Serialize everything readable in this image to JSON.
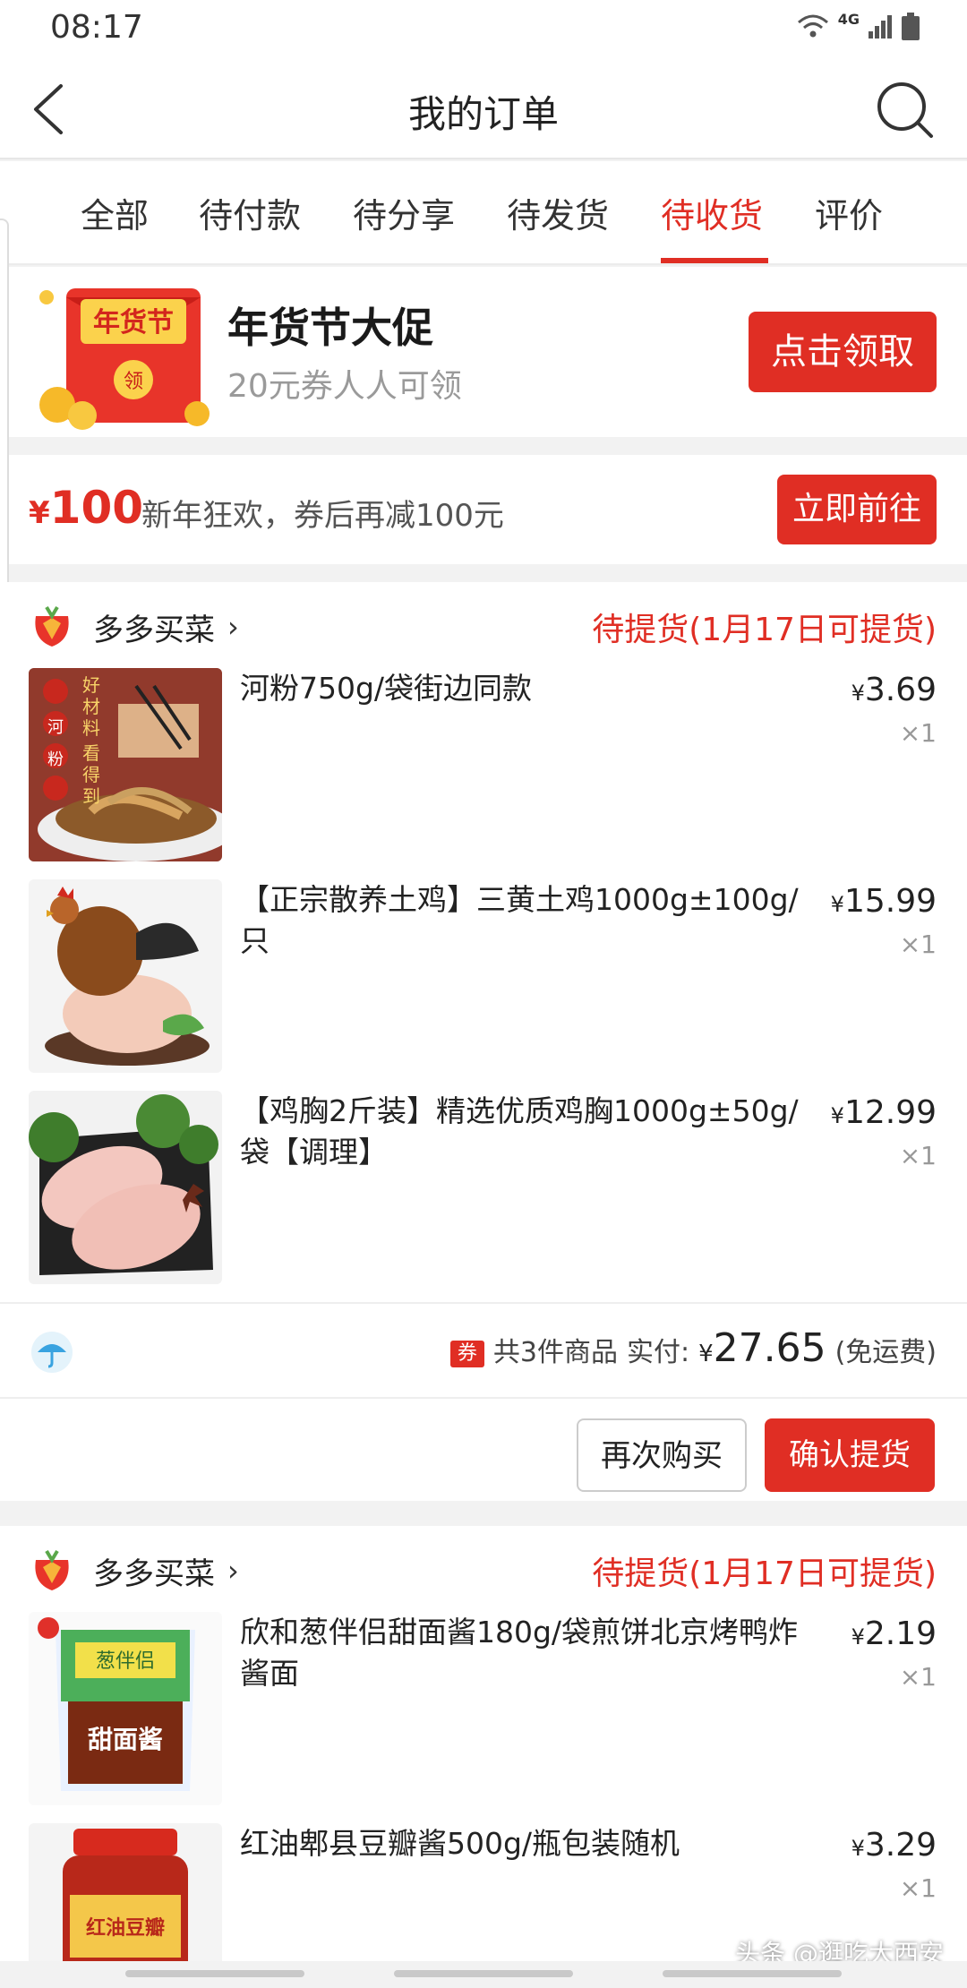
{
  "status_bar": {
    "time": "08:17",
    "network": "4G"
  },
  "header": {
    "title": "我的订单"
  },
  "tabs": [
    {
      "label": "全部"
    },
    {
      "label": "待付款"
    },
    {
      "label": "待分享"
    },
    {
      "label": "待发货"
    },
    {
      "label": "待收货",
      "active": true
    },
    {
      "label": "评价"
    }
  ],
  "promo_banner": {
    "art_text": "年货节",
    "art_badge": "领",
    "title": "年货节大促",
    "subtitle": "20元券人人可领",
    "button": "点击领取"
  },
  "coupon_banner": {
    "currency": "¥",
    "amount": "100",
    "description": "新年狂欢，券后再减100元",
    "button": "立即前往"
  },
  "orders": [
    {
      "store": "多多买菜",
      "status": "待提货(1月17日可提货)",
      "items": [
        {
          "name": "河粉750g/袋街边同款",
          "currency": "¥",
          "price": "3.69",
          "qty": "×1"
        },
        {
          "name": "【正宗散养土鸡】三黄土鸡1000g±100g/只",
          "currency": "¥",
          "price": "15.99",
          "qty": "×1"
        },
        {
          "name": "【鸡胸2斤装】精选优质鸡胸1000g±50g/袋【调理】",
          "currency": "¥",
          "price": "12.99",
          "qty": "×1"
        }
      ],
      "coupon_tag": "券",
      "summary_count": "共3件商品",
      "paid_label": "实付:",
      "currency": "¥",
      "total": "27.65",
      "shipping": "(免运费)",
      "buttons": {
        "rebuy": "再次购买",
        "confirm": "确认提货"
      }
    },
    {
      "store": "多多买菜",
      "status": "待提货(1月17日可提货)",
      "items": [
        {
          "name": "欣和葱伴侣甜面酱180g/袋煎饼北京烤鸭炸酱面",
          "currency": "¥",
          "price": "2.19",
          "qty": "×1",
          "thumb_text": "甜面酱",
          "thumb_brand": "葱伴侣"
        },
        {
          "name": "红油郫县豆瓣酱500g/瓶包装随机",
          "currency": "¥",
          "price": "3.29",
          "qty": "×1",
          "thumb_text": "红油豆瓣"
        }
      ]
    }
  ],
  "noodle_thumb_text": [
    "好",
    "材",
    "料",
    "看",
    "得",
    "到",
    "河",
    "粉"
  ],
  "watermark": "头条 @逛吃大西安",
  "colors": {
    "accent": "#e02e24"
  }
}
